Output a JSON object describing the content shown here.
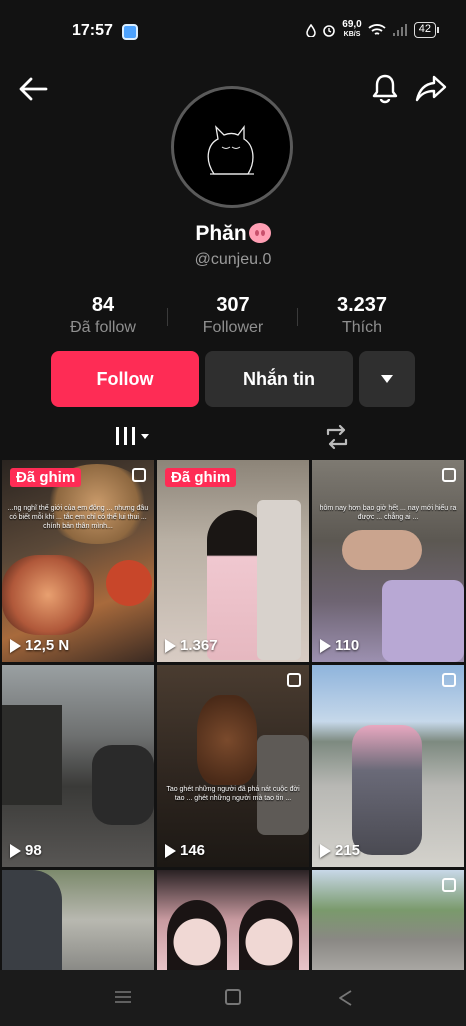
{
  "status_bar": {
    "time": "17:57",
    "speed_value": "69,0",
    "speed_unit": "KB/S",
    "battery": "42"
  },
  "profile": {
    "display_name": "Phăn",
    "username": "@cunjeu.0"
  },
  "stats": [
    {
      "value": "84",
      "label": "Đã follow"
    },
    {
      "value": "307",
      "label": "Follower"
    },
    {
      "value": "3.237",
      "label": "Thích"
    }
  ],
  "actions": {
    "follow_label": "Follow",
    "message_label": "Nhắn tin"
  },
  "videos": [
    {
      "views": "12,5 N",
      "pinned_label": "Đã ghim",
      "caption": "...ng nghĩ thế giới của em đông ... nhưng đâu có biết mỗi khi ... tắc em chỉ có thể lui thui ... chính bản thân mình..."
    },
    {
      "views": "1.367",
      "pinned_label": "Đã ghim",
      "caption": ""
    },
    {
      "views": "110",
      "pinned_label": "",
      "caption": "hôm nay hơn bao giờ hết ... nay mới hiểu ra được ... chẳng ai ..."
    },
    {
      "views": "98",
      "pinned_label": "",
      "caption": ""
    },
    {
      "views": "146",
      "pinned_label": "",
      "caption": "Tao ghét những người đã phá nát cuộc đời tao ... ghét những người mà tao tin ..."
    },
    {
      "views": "215",
      "pinned_label": "",
      "caption": ""
    },
    {
      "views": "",
      "pinned_label": "",
      "caption": ""
    },
    {
      "views": "",
      "pinned_label": "",
      "caption": ""
    },
    {
      "views": "",
      "pinned_label": "",
      "caption": ""
    }
  ],
  "colors": {
    "accent": "#fe2c55",
    "background": "#121212",
    "secondary_button": "#2f2f2f"
  }
}
